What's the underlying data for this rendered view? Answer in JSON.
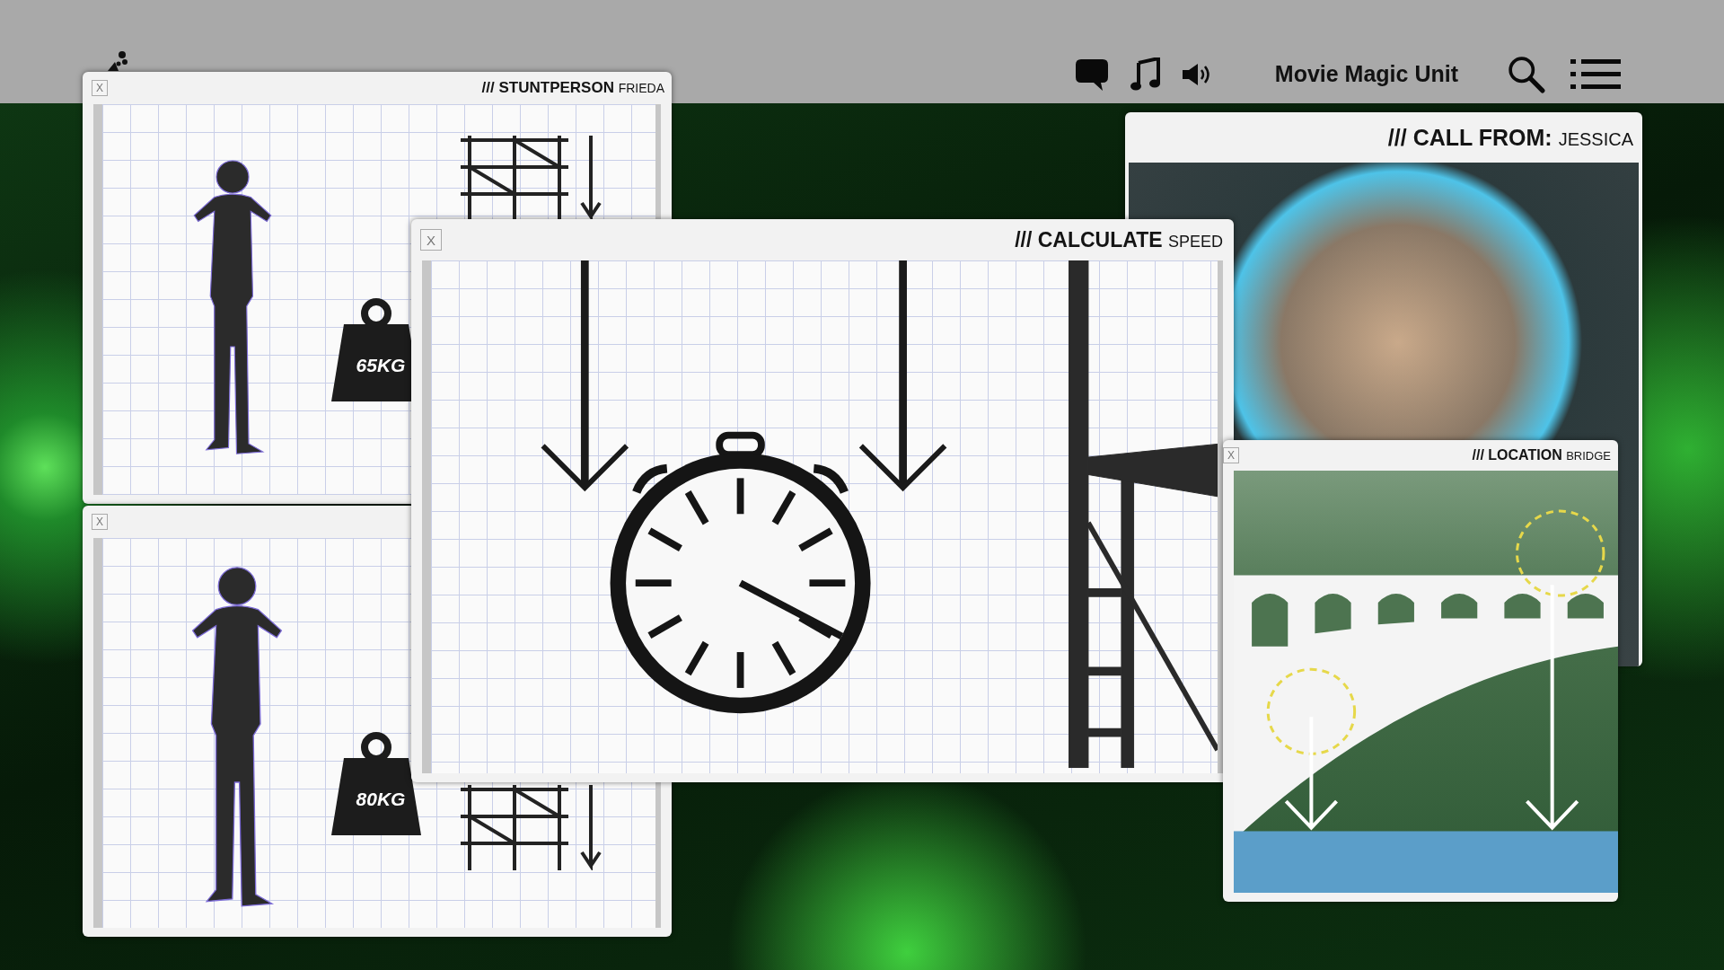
{
  "top_bar": {
    "title": "Movie Magic Unit"
  },
  "windows": [
    {
      "kind": "stuntperson",
      "close": "X",
      "title": "/// STUNTPERSON",
      "subtitle": "FRIEDA",
      "weight": "65KG"
    },
    {
      "kind": "stuntperson",
      "close": "X",
      "weight": "80KG"
    },
    {
      "kind": "call",
      "title": "/// CALL FROM:",
      "subtitle": "JESSICA"
    },
    {
      "kind": "speed",
      "close": "X",
      "title": "/// CALCULATE",
      "subtitle": "SPEED"
    },
    {
      "kind": "location",
      "close": "X",
      "title": "/// LOCATION",
      "subtitle": "BRIDGE"
    }
  ]
}
